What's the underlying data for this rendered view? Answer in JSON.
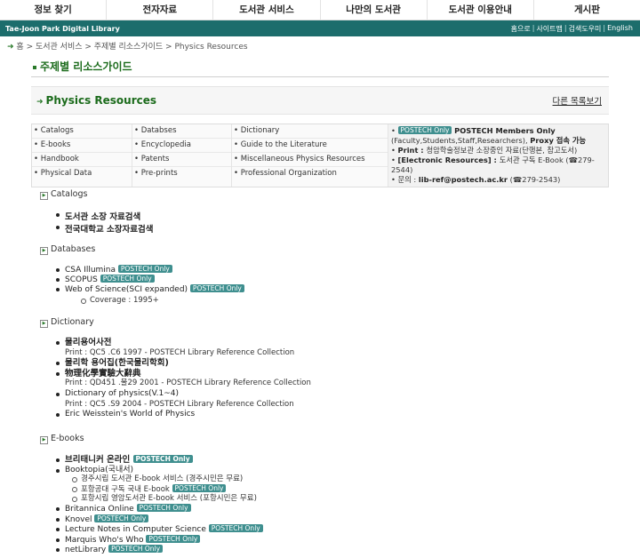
{
  "topnav": [
    "정보 찾기",
    "전자자료",
    "도서관 서비스",
    "나만의 도서관",
    "도서관 이용안내",
    "게시판"
  ],
  "greenbar": {
    "brand": "Tae-Joon Park Digital Library",
    "util": [
      "홈으로",
      "사이트맵",
      "검색도우미",
      "English"
    ]
  },
  "breadcrumb": [
    "홈",
    "도서관 서비스",
    "주제별 리소스가이드",
    "Physics Resources"
  ],
  "page_title": "주제별 리소스가이드",
  "section": {
    "title": "Physics Resources",
    "list_link": "다른 목록보기"
  },
  "categories": {
    "col1": [
      "Catalogs",
      "E-books",
      "Handbook",
      "Physical Data"
    ],
    "col2": [
      "Databses",
      "Encyclopedia",
      "Patents",
      "Pre-prints"
    ],
    "col3": [
      "Dictionary",
      "Guide to the Literature",
      "Miscellaneous Physics Resources",
      "Professional Organization"
    ]
  },
  "info": {
    "badge": "POSTECH Only",
    "members": "POSTECH Members Only",
    "members_detail": "(Faculty,Students,Staff,Researchers), ",
    "proxy": "Proxy 접속 가능",
    "print_label": "Print : ",
    "print_text": "청암학술정보관 소장중인 자료(단행본, 참고도서)",
    "eres_label": "[Electronic Resources] : ",
    "eres_text": "도서관 구독 E-Book (☎279-2544)",
    "contact_label": "문의 : ",
    "contact_email": "lib-ref@postech.ac.kr",
    "contact_phone": " (☎279-2543)"
  },
  "sections": {
    "catalogs": {
      "label": "Catalogs",
      "items": [
        "도서관 소장 자료검색",
        "전국대학교 소장자료검색"
      ]
    },
    "databases": {
      "label": "Databases",
      "items": [
        "CSA Illumina",
        "SCOPUS",
        "Web of Science(SCI expanded)"
      ],
      "coverage": "Coverage : 1995+"
    },
    "dictionary": {
      "label": "Dictionary",
      "items": [
        {
          "title": "물리용어사전",
          "sub": "Print : QC5 .C6 1997 - POSTECH Library Reference Collection"
        },
        {
          "title": "물리학 용어집(한국물리학회)",
          "sub": ""
        },
        {
          "title": "物理化學實驗大辭典",
          "sub": "Print : QD451 .물29 2001 - POSTECH Library Reference Collection"
        },
        {
          "title": "Dictionary of physics(V.1~4)",
          "sub": "Print : QC5 .S9 2004 - POSTECH Library Reference Collection"
        },
        {
          "title": "Eric Weisstein's World of Physics",
          "sub": ""
        }
      ]
    },
    "ebooks": {
      "label": "E-books",
      "britannica": "브리태니커 온라인",
      "booktopia": "Booktopia(국내서)",
      "booktopia_sub": [
        "경주시립 도서관 E-book 서비스 (경주시민은 무료)",
        "포항공대 구독 국내 E-book",
        "포항시립 영암도서관 E-book 서비스 (포항시민은 무료)"
      ],
      "items": [
        "Britannica Online",
        "Knovel",
        "Lecture Notes in Computer Science",
        "Marquis Who's Who",
        "netLibrary"
      ]
    }
  }
}
